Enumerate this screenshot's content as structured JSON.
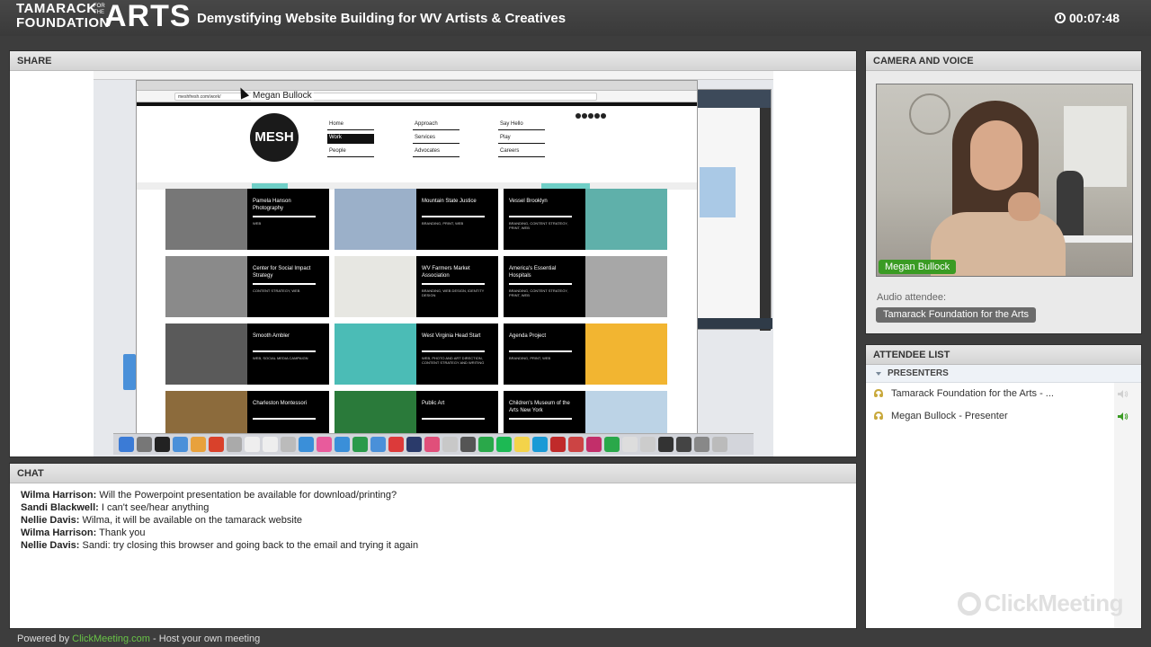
{
  "header": {
    "logo_line1": "TAMARACK",
    "logo_line2": "FOUNDATION",
    "logo_ftt": "FOR THE",
    "logo_arts": "ARTS",
    "title": "Demystifying Website Building for WV Artists & Creatives",
    "timer": "00:07:48"
  },
  "share": {
    "heading": "SHARE",
    "presenter_overlay": "Megan Bullock",
    "browser_url": "meshfresh.com/work/",
    "site": {
      "logo": "MESH",
      "nav": [
        [
          "Home",
          "Work",
          "People"
        ],
        [
          "Approach",
          "Services",
          "Advocates"
        ],
        [
          "Say Hello",
          "Play",
          "Careers"
        ]
      ],
      "active_nav": "Work",
      "tiles": [
        {
          "title": "Pamela Hanson Photography",
          "sub": "WEB"
        },
        {
          "title": "Mountain State Justice",
          "sub": "BRANDING, PRINT, WEB"
        },
        {
          "title": "Vessel Brooklyn",
          "sub": "BRANDING, CONTENT STRATEGY, PRINT, WEB"
        },
        {
          "title": "Center for Social Impact Strategy",
          "sub": "CONTENT STRATEGY, WEB"
        },
        {
          "title": "WV Farmers Market Association",
          "sub": "BRANDING, WEB DESIGN, IDENTITY DESIGN"
        },
        {
          "title": "America's Essential Hospitals",
          "sub": "BRANDING, CONTENT STRATEGY, PRINT, WEB"
        },
        {
          "title": "Smooth Ambler",
          "sub": "WEB, SOCIAL MEDIA CAMPAIGN"
        },
        {
          "title": "West Virginia Head Start",
          "sub": "WEB, PHOTO AND ART DIRECTION, CONTENT STRATEGY AND WRITING"
        },
        {
          "title": "Agenda Project",
          "sub": "BRANDING, PRINT, WEB"
        },
        {
          "title": "Charleston Montessori",
          "sub": ""
        },
        {
          "title": "Public Art",
          "sub": ""
        },
        {
          "title": "Children's Museum of the Arts New York",
          "sub": ""
        }
      ]
    }
  },
  "camera": {
    "heading": "CAMERA AND VOICE",
    "presenter_name": "Megan Bullock",
    "audio_label": "Audio attendee:",
    "audio_attendee": "Tamarack Foundation for the Arts"
  },
  "attendees": {
    "heading": "ATTENDEE LIST",
    "presenters_label": "PRESENTERS",
    "list": [
      {
        "name": "Tamarack Foundation for the Arts - ...",
        "speaking": false
      },
      {
        "name": "Megan Bullock - Presenter",
        "speaking": true
      }
    ],
    "watermark": "ClickMeeting"
  },
  "chat": {
    "heading": "CHAT",
    "messages": [
      {
        "author": "Wilma Harrison:",
        "text": "Will the Powerpoint presentation be available for download/printing?"
      },
      {
        "author": "Sandi Blackwell:",
        "text": "I can't see/hear anything"
      },
      {
        "author": "Nellie Davis:",
        "text": "Wilma, it will be available on the tamarack website"
      },
      {
        "author": "Wilma Harrison:",
        "text": "Thank you"
      },
      {
        "author": "Nellie Davis:",
        "text": "Sandi: try closing this browser and going back to the email and trying it again"
      }
    ]
  },
  "footer": {
    "prefix": "Powered by",
    "link": "ClickMeeting.com",
    "suffix": "- Host your own meeting"
  },
  "colors": {
    "accent_green": "#3a9b23",
    "link_green": "#69c447",
    "topbar": "#3d3d3d"
  }
}
